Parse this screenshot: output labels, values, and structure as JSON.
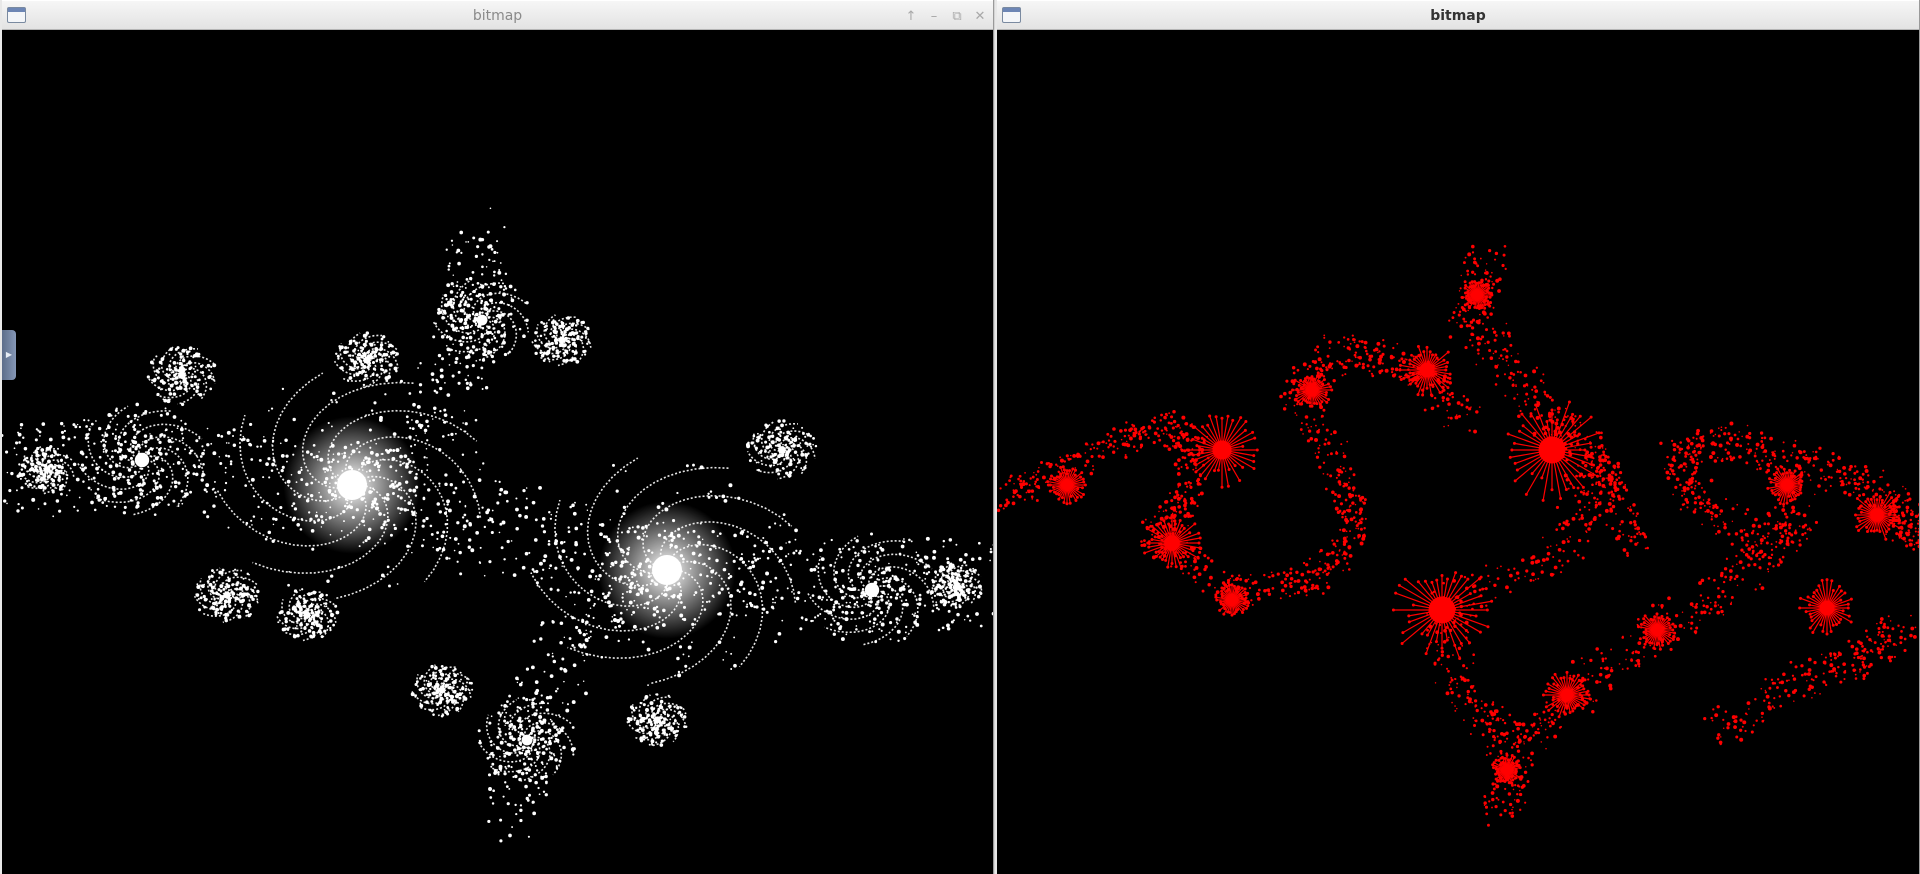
{
  "windows": {
    "left": {
      "title": "bitmap",
      "controls": {
        "up_icon": "arrow-up-icon",
        "minimize_icon": "minimize-icon",
        "restore_icon": "restore-icon",
        "close_icon": "close-icon"
      },
      "image": {
        "subject": "julia-set-fractal",
        "fractal_color": "#ffffff",
        "background_color": "#000000"
      }
    },
    "right": {
      "title": "bitmap",
      "image": {
        "subject": "julia-set-fractal",
        "fractal_color": "#ff0000",
        "background_color": "#000000"
      }
    }
  },
  "side_tab": {
    "icon": "expand-arrow-icon"
  },
  "colors": {
    "titlebar": "#e8e8e8",
    "inactive_title_text": "#8a8a8a",
    "active_title_text": "#333333"
  }
}
